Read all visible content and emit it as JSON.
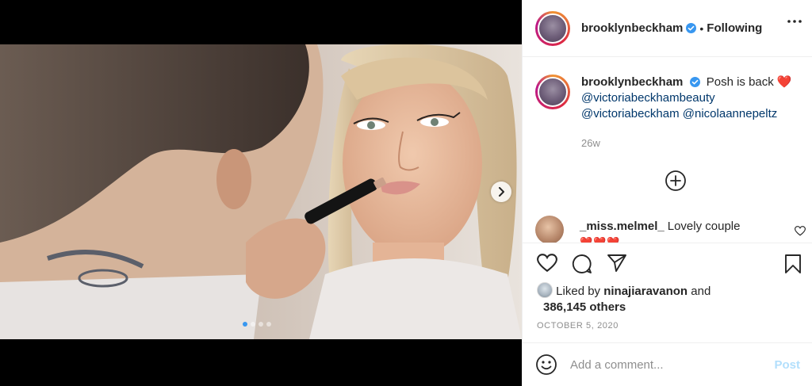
{
  "post": {
    "username": "brooklynbeckham",
    "follow_state": "Following",
    "separator": "•",
    "carousel": {
      "slide_count": 4,
      "active_index": 0
    }
  },
  "caption": {
    "username": "brooklynbeckham",
    "text": "Posh is back",
    "emoji": "❤️",
    "mention_1": "@victoriabeckhambeauty",
    "mention_2": "@victoriabeckham",
    "mention_3": "@nicolaannepeltz",
    "age": "26w"
  },
  "comment": {
    "username": "_miss.melmel_",
    "text": "Lovely couple",
    "emojis": "❤️❤️❤️"
  },
  "likes": {
    "prefix": "Liked by",
    "user": "ninajiaravanon",
    "joiner": "and",
    "count_text": "386,145 others"
  },
  "date": "OCTOBER 5, 2020",
  "composer": {
    "placeholder": "Add a comment...",
    "post_label": "Post"
  },
  "colors": {
    "link": "#00376b",
    "verified": "#3897f0",
    "post_disabled": "#b2dffc",
    "heart": "#e0245e"
  },
  "icons": [
    "verified-badge-icon",
    "more-options-icon",
    "chevron-right-icon",
    "add-circle-icon",
    "heart-icon",
    "comment-icon",
    "share-icon",
    "bookmark-icon",
    "emoji-icon"
  ]
}
